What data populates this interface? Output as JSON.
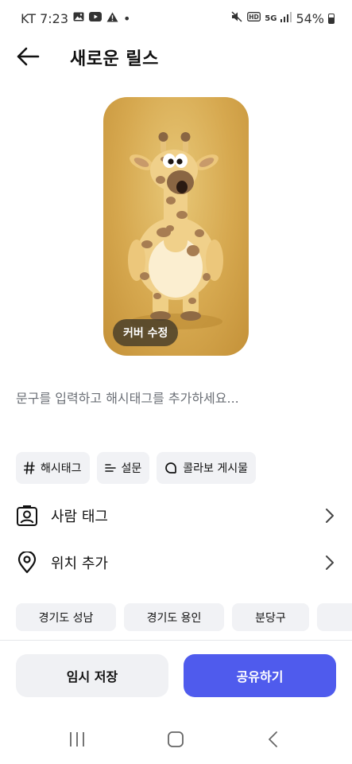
{
  "status_bar": {
    "carrier_time": "KT 7:23",
    "dot": "•",
    "network": "5G",
    "battery": "54%",
    "icons": [
      "gallery-icon",
      "youtube-icon",
      "warning-icon",
      "mute-icon",
      "hd-icon",
      "signal-icon",
      "battery-icon"
    ]
  },
  "header": {
    "title": "새로운 릴스"
  },
  "cover": {
    "edit_label": "커버 수정"
  },
  "caption": {
    "placeholder": "문구를 입력하고 해시태그를 추가하세요..."
  },
  "chips": [
    {
      "icon": "hash-icon",
      "label": "해시태그"
    },
    {
      "icon": "poll-icon",
      "label": "설문"
    },
    {
      "icon": "collab-icon",
      "label": "콜라보 게시물"
    }
  ],
  "rows": {
    "people": {
      "label": "사람 태그"
    },
    "location": {
      "label": "위치 추가"
    }
  },
  "locations": [
    "경기도 성남",
    "경기도 용인",
    "분당구",
    ""
  ],
  "actions": {
    "draft": "임시 저장",
    "share": "공유하기"
  },
  "colors": {
    "accent": "#4f5bed",
    "chip_bg": "#f1f2f5",
    "placeholder": "#6b6f76"
  }
}
